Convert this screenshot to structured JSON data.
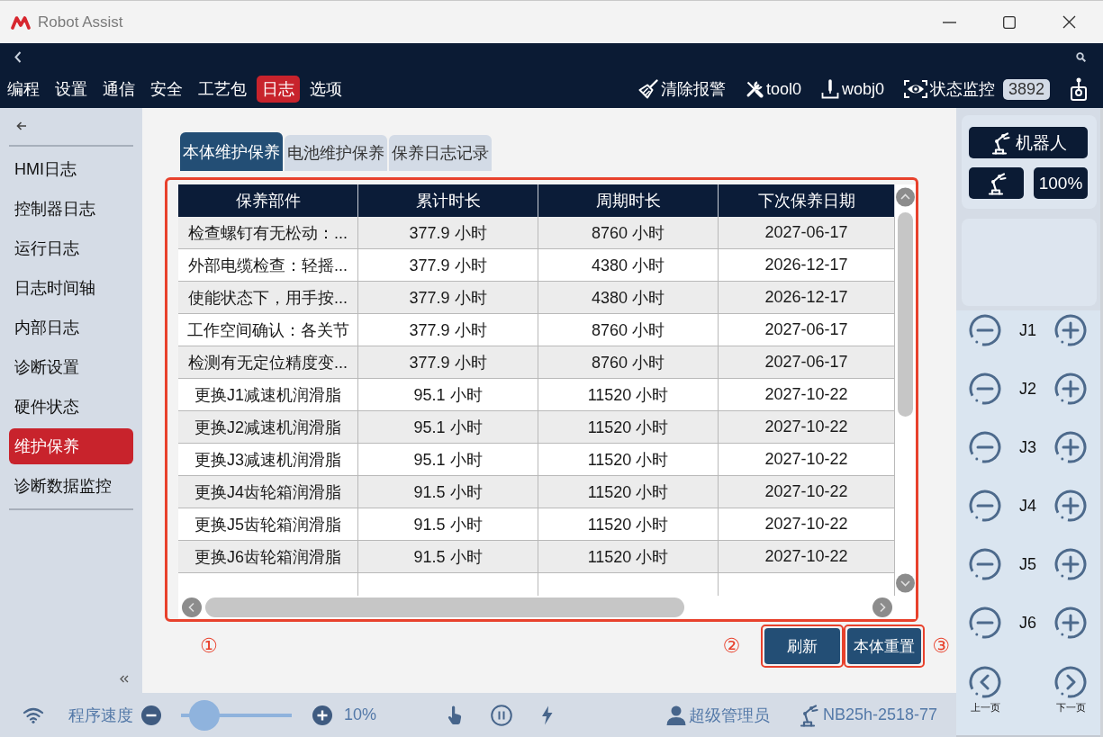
{
  "window": {
    "title": "Robot Assist"
  },
  "menu": [
    {
      "label": "编程",
      "selected": false
    },
    {
      "label": "设置",
      "selected": false
    },
    {
      "label": "通信",
      "selected": false
    },
    {
      "label": "安全",
      "selected": false
    },
    {
      "label": "工艺包",
      "selected": false
    },
    {
      "label": "日志",
      "selected": true
    },
    {
      "label": "选项",
      "selected": false
    }
  ],
  "toolbar": [
    {
      "kind": "clear-alarm",
      "label": "清除报警"
    },
    {
      "kind": "tool",
      "label": "tool0"
    },
    {
      "kind": "workobject",
      "label": "wobj0"
    },
    {
      "kind": "monitor",
      "label": "状态监控",
      "badge": "3892"
    }
  ],
  "sidebar": {
    "items": [
      {
        "label": "HMI日志",
        "selected": false
      },
      {
        "label": "控制器日志",
        "selected": false
      },
      {
        "label": "运行日志",
        "selected": false
      },
      {
        "label": "日志时间轴",
        "selected": false
      },
      {
        "label": "内部日志",
        "selected": false
      },
      {
        "label": "诊断设置",
        "selected": false
      },
      {
        "label": "硬件状态",
        "selected": false
      },
      {
        "label": "维护保养",
        "selected": true
      },
      {
        "label": "诊断数据监控",
        "selected": false
      }
    ]
  },
  "tabs": [
    {
      "label": "本体维护保养",
      "selected": true
    },
    {
      "label": "电池维护保养",
      "selected": false
    },
    {
      "label": "保养日志记录",
      "selected": false
    }
  ],
  "table": {
    "highlighted": true,
    "callout": "①",
    "columns": [
      "保养部件",
      "累计时长",
      "周期时长",
      "下次保养日期"
    ],
    "rows": [
      [
        "检查螺钉有无松动：...",
        "377.9 小时",
        "8760 小时",
        "2027-06-17"
      ],
      [
        "外部电缆检查：轻摇...",
        "377.9 小时",
        "4380 小时",
        "2026-12-17"
      ],
      [
        "使能状态下，用手按...",
        "377.9 小时",
        "4380 小时",
        "2026-12-17"
      ],
      [
        "工作空间确认：各关节",
        "377.9 小时",
        "8760 小时",
        "2027-06-17"
      ],
      [
        "检测有无定位精度变...",
        "377.9 小时",
        "8760 小时",
        "2027-06-17"
      ],
      [
        "更换J1减速机润滑脂",
        "95.1 小时",
        "11520 小时",
        "2027-10-22"
      ],
      [
        "更换J2减速机润滑脂",
        "95.1 小时",
        "11520 小时",
        "2027-10-22"
      ],
      [
        "更换J3减速机润滑脂",
        "95.1 小时",
        "11520 小时",
        "2027-10-22"
      ],
      [
        "更换J4齿轮箱润滑脂",
        "91.5 小时",
        "11520 小时",
        "2027-10-22"
      ],
      [
        "更换J5齿轮箱润滑脂",
        "91.5 小时",
        "11520 小时",
        "2027-10-22"
      ],
      [
        "更换J6齿轮箱润滑脂",
        "91.5 小时",
        "11520 小时",
        "2027-10-22"
      ]
    ]
  },
  "buttons": [
    {
      "label": "刷新",
      "highlighted": true,
      "callout": "②"
    },
    {
      "label": "本体重置",
      "highlighted": true,
      "callout": "③"
    }
  ],
  "robot_panel": {
    "mode_button": "机器人",
    "speed_button": "100%"
  },
  "joints": [
    {
      "label": "J1"
    },
    {
      "label": "J2"
    },
    {
      "label": "J3"
    },
    {
      "label": "J4"
    },
    {
      "label": "J5"
    },
    {
      "label": "J6"
    }
  ],
  "page_nav": {
    "previous": "上一页",
    "next": "下一页"
  },
  "status_bar": {
    "speed_label": "程序速度",
    "speed": {
      "level": 0.1,
      "reading": "10%"
    },
    "user": "超级管理员",
    "controller": "NB25h-2518-77"
  }
}
